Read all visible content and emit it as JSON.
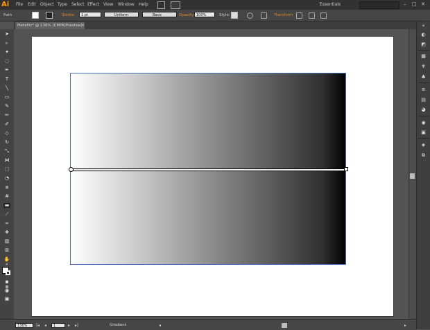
{
  "app": {
    "logo": "Ai",
    "menu": [
      "File",
      "Edit",
      "Object",
      "Type",
      "Select",
      "Effect",
      "View",
      "Window",
      "Help"
    ],
    "workspace": "Essentials",
    "window_controls": [
      "–",
      "□",
      "✕"
    ]
  },
  "control_bar": {
    "selection_label": "Path",
    "stroke_label": "Stroke:",
    "stroke_weight": "1 pt",
    "profile_uniform": "Uniform",
    "brush_basic": "Basic",
    "opacity_label": "Opacity:",
    "opacity_value": "100%",
    "style_label": "Style:",
    "transform_label": "Transform"
  },
  "document": {
    "tab_title": "Metallic* @ 136% (CMYK/Preview)",
    "tab_close": "×"
  },
  "status_bar": {
    "zoom": "136%",
    "page": "1",
    "tool": "Gradient"
  },
  "colors": {
    "accent_orange": "#e58a23",
    "selection_blue": "#4a6dbf",
    "gradient_start": "#ffffff",
    "gradient_end": "#000000"
  },
  "icons": {
    "tools": [
      "selection-icon",
      "direct-selection-icon",
      "magic-wand-icon",
      "lasso-icon",
      "pen-icon",
      "type-icon",
      "line-segment-icon",
      "rectangle-icon",
      "paintbrush-icon",
      "pencil-icon",
      "blob-brush-icon",
      "eraser-icon",
      "rotate-icon",
      "scale-icon",
      "width-icon",
      "free-transform-icon",
      "shape-builder-icon",
      "perspective-grid-icon",
      "mesh-icon",
      "gradient-icon",
      "eyedropper-icon",
      "blend-icon",
      "symbol-sprayer-icon",
      "column-graph-icon",
      "artboard-icon",
      "slice-icon",
      "hand-icon",
      "zoom-icon"
    ],
    "panels": [
      "color-icon",
      "color-guide-icon",
      "swatches-icon",
      "brushes-icon",
      "symbols-icon",
      "stroke-icon",
      "gradient-panel-icon",
      "transparency-icon",
      "appearance-icon",
      "graphic-styles-icon",
      "layers-icon",
      "artboards-icon"
    ]
  }
}
